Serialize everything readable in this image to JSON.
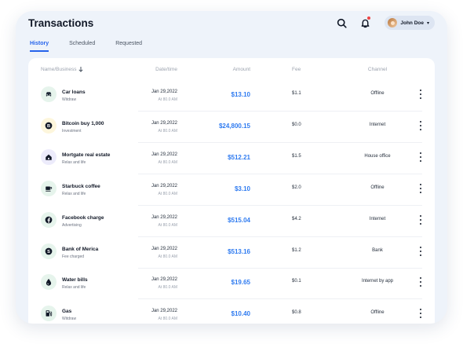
{
  "page": {
    "title": "Transactions"
  },
  "header": {
    "user_name": "John Doe"
  },
  "tabs": [
    {
      "label": "History",
      "active": true
    },
    {
      "label": "Scheduled",
      "active": false
    },
    {
      "label": "Requested",
      "active": false
    }
  ],
  "table": {
    "columns": {
      "name": "Name/Business",
      "date": "Date/time",
      "amount": "Amount",
      "fee": "Fee",
      "channel": "Channel"
    },
    "rows": [
      {
        "icon": "car-icon",
        "icon_bg": "#e6f4ec",
        "name": "Car loans",
        "sub": "Witdraw",
        "date": "Jan 29,2022",
        "time": "At 80.0 AM",
        "amount": "$13.10",
        "fee": "$1.1",
        "channel": "Offline"
      },
      {
        "icon": "bitcoin-icon",
        "icon_bg": "#fdf6dc",
        "name": "Bitcoin buy 1,000",
        "sub": "Investment",
        "date": "Jan 29,2022",
        "time": "At 80.0 AM",
        "amount": "$24,800.15",
        "fee": "$0.0",
        "channel": "Internet"
      },
      {
        "icon": "home-icon",
        "icon_bg": "#ecebfb",
        "name": "Mortgate real estate",
        "sub": "Relax and life",
        "date": "Jan 29,2022",
        "time": "At 80.0 AM",
        "amount": "$512.21",
        "fee": "$1.5",
        "channel": "House office"
      },
      {
        "icon": "coffee-icon",
        "icon_bg": "#e6f4ec",
        "name": "Starbuck coffee",
        "sub": "Relax and life",
        "date": "Jan 29,2022",
        "time": "At 80.0 AM",
        "amount": "$3.10",
        "fee": "$2.0",
        "channel": "Offline"
      },
      {
        "icon": "facebook-icon",
        "icon_bg": "#e6f4ec",
        "name": "Facebook charge",
        "sub": "Advertising",
        "date": "Jan 29,2022",
        "time": "At 80.0 AM",
        "amount": "$515.04",
        "fee": "$4.2",
        "channel": "Internet"
      },
      {
        "icon": "bank-icon",
        "icon_bg": "#e6f4ec",
        "name": "Bank of Merica",
        "sub": "Fee charged",
        "date": "Jan 29,2022",
        "time": "At 80.0 AM",
        "amount": "$513.16",
        "fee": "$1.2",
        "channel": "Bank"
      },
      {
        "icon": "water-drop-icon",
        "icon_bg": "#e6f4ec",
        "name": "Water bills",
        "sub": "Relax and life",
        "date": "Jan 29,2022",
        "time": "At 80.0 AM",
        "amount": "$19.65",
        "fee": "$0.1",
        "channel": "Internet by app"
      },
      {
        "icon": "gas-station-icon",
        "icon_bg": "#e6f4ec",
        "name": "Gas",
        "sub": "Witdraw",
        "date": "Jan 29,2022",
        "time": "At 80.0 AM",
        "amount": "$10.40",
        "fee": "$0.8",
        "channel": "Offline"
      }
    ]
  },
  "colors": {
    "accent": "#2563eb",
    "amount": "#2f7bf0",
    "notification_dot": "#ef4444"
  }
}
